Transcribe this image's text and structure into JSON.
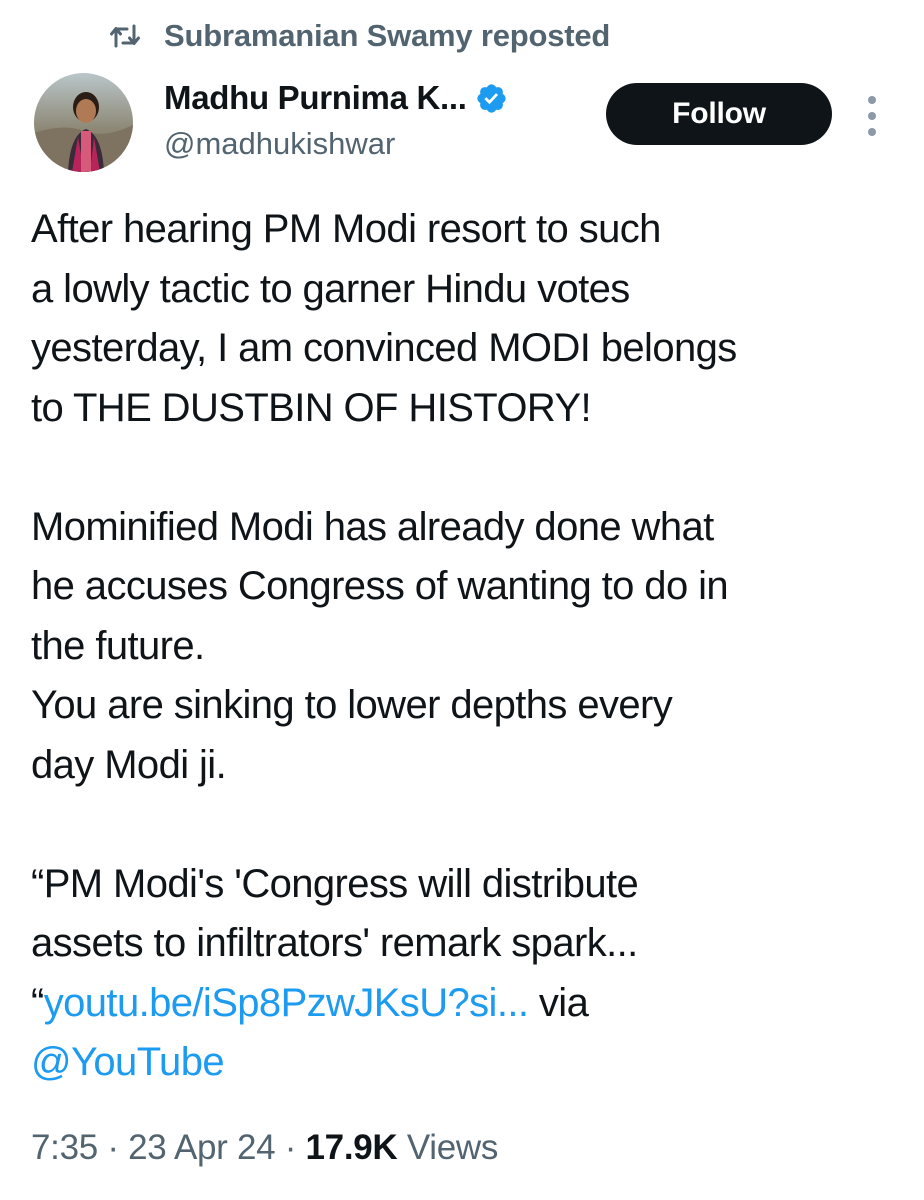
{
  "repost": {
    "icon": "repost-icon",
    "text": "Subramanian Swamy reposted"
  },
  "author": {
    "display_name": "Madhu Purnima K...",
    "handle": "@madhukishwar",
    "verified_icon": "verified-badge-icon",
    "verified_color": "#1d9bf0"
  },
  "follow_button": {
    "label": "Follow",
    "background": "#0f1419"
  },
  "more_menu": {
    "icon": "more-vertical-icon"
  },
  "tweet": {
    "lines_p1": [
      "After hearing PM Modi resort to such",
      "a lowly tactic to garner Hindu votes",
      "yesterday, I am convinced MODI belongs",
      "to THE DUSTBIN OF HISTORY!"
    ],
    "lines_p2": [
      "Mominified Modi has already done what",
      "he accuses Congress of wanting to do in",
      "the future.",
      "You are sinking to lower depths every",
      "day Modi ji."
    ],
    "quote_line_1": "“PM Modi's 'Congress will distribute",
    "quote_line_2": "assets to infiltrators' remark spark...",
    "quote_open": "“",
    "link_text": "youtu.be/iSp8PzwJKsU?si...",
    "via_text": " via",
    "mention": "@YouTube"
  },
  "meta": {
    "time": "7:35",
    "separator_1": " · ",
    "date": "23 Apr 24",
    "separator_2": " · ",
    "views_count": "17.9K",
    "views_label": " Views"
  },
  "colors": {
    "link": "#1d9bf0",
    "secondary_text": "#536471",
    "primary_text": "#0f1419"
  }
}
